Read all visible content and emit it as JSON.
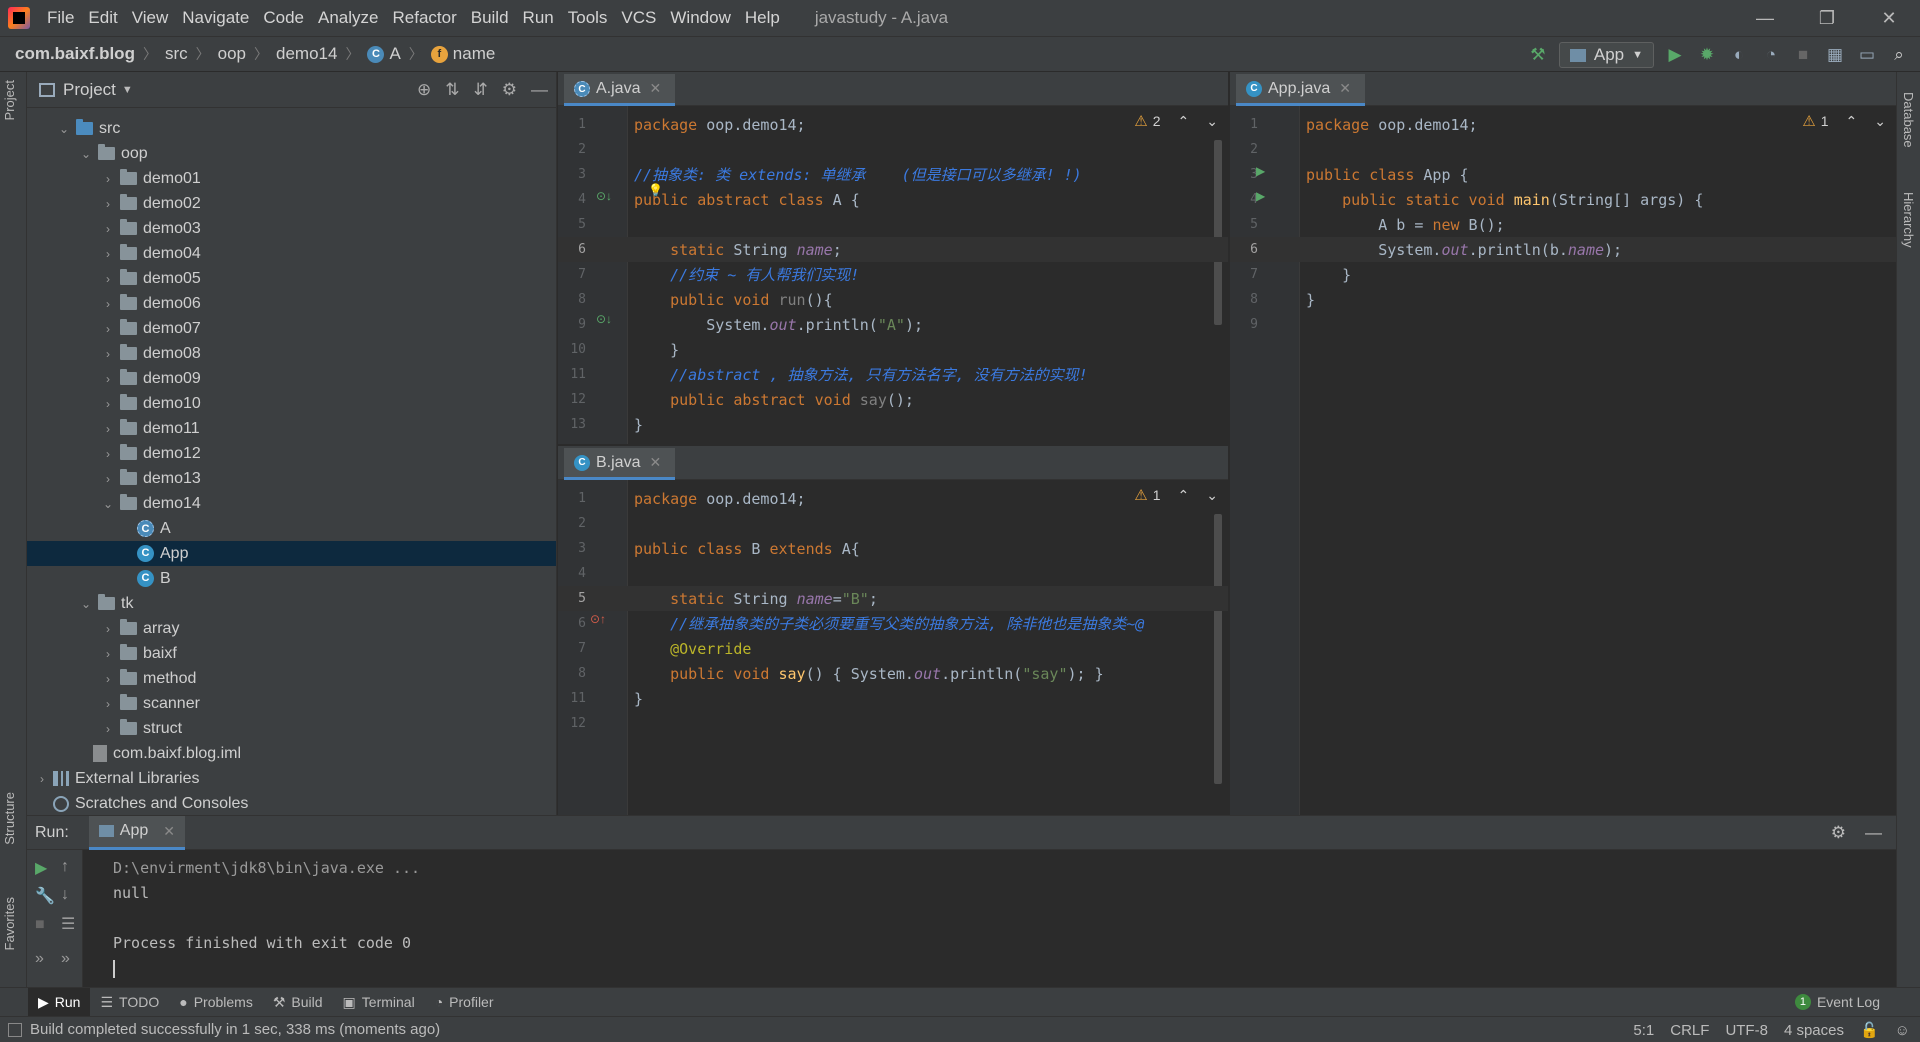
{
  "menu": [
    "File",
    "Edit",
    "View",
    "Navigate",
    "Code",
    "Analyze",
    "Refactor",
    "Build",
    "Run",
    "Tools",
    "VCS",
    "Window",
    "Help"
  ],
  "window_title": "javastudy - A.java",
  "breadcrumbs": [
    "com.baixf.blog",
    "src",
    "oop",
    "demo14",
    "A",
    "name"
  ],
  "run_config": "App",
  "project_pane": {
    "title": "Project",
    "tree": [
      {
        "label": "src",
        "indent": 1,
        "type": "src-folder",
        "arrow": "⌄"
      },
      {
        "label": "oop",
        "indent": 2,
        "type": "folder",
        "arrow": "⌄"
      },
      {
        "label": "demo01",
        "indent": 3,
        "type": "folder",
        "arrow": "›"
      },
      {
        "label": "demo02",
        "indent": 3,
        "type": "folder",
        "arrow": "›"
      },
      {
        "label": "demo03",
        "indent": 3,
        "type": "folder",
        "arrow": "›"
      },
      {
        "label": "demo04",
        "indent": 3,
        "type": "folder",
        "arrow": "›"
      },
      {
        "label": "demo05",
        "indent": 3,
        "type": "folder",
        "arrow": "›"
      },
      {
        "label": "demo06",
        "indent": 3,
        "type": "folder",
        "arrow": "›"
      },
      {
        "label": "demo07",
        "indent": 3,
        "type": "folder",
        "arrow": "›"
      },
      {
        "label": "demo08",
        "indent": 3,
        "type": "folder",
        "arrow": "›"
      },
      {
        "label": "demo09",
        "indent": 3,
        "type": "folder",
        "arrow": "›"
      },
      {
        "label": "demo10",
        "indent": 3,
        "type": "folder",
        "arrow": "›"
      },
      {
        "label": "demo11",
        "indent": 3,
        "type": "folder",
        "arrow": "›"
      },
      {
        "label": "demo12",
        "indent": 3,
        "type": "folder",
        "arrow": "›"
      },
      {
        "label": "demo13",
        "indent": 3,
        "type": "folder",
        "arrow": "›"
      },
      {
        "label": "demo14",
        "indent": 3,
        "type": "folder",
        "arrow": "⌄"
      },
      {
        "label": "A",
        "indent": 4,
        "type": "abstract-class",
        "arrow": ""
      },
      {
        "label": "App",
        "indent": 4,
        "type": "class",
        "arrow": "",
        "selected": true
      },
      {
        "label": "B",
        "indent": 4,
        "type": "class",
        "arrow": ""
      },
      {
        "label": "tk",
        "indent": 2,
        "type": "folder",
        "arrow": "⌄"
      },
      {
        "label": "array",
        "indent": 3,
        "type": "folder",
        "arrow": "›"
      },
      {
        "label": "baixf",
        "indent": 3,
        "type": "folder",
        "arrow": "›"
      },
      {
        "label": "method",
        "indent": 3,
        "type": "folder",
        "arrow": "›"
      },
      {
        "label": "scanner",
        "indent": 3,
        "type": "folder",
        "arrow": "›"
      },
      {
        "label": "struct",
        "indent": 3,
        "type": "folder",
        "arrow": "›"
      },
      {
        "label": "com.baixf.blog.iml",
        "indent": 2,
        "type": "file",
        "arrow": ""
      },
      {
        "label": "External Libraries",
        "indent": 0,
        "type": "library",
        "arrow": "›"
      },
      {
        "label": "Scratches and Consoles",
        "indent": 0,
        "type": "scratch",
        "arrow": ""
      }
    ]
  },
  "editors": {
    "a_java": {
      "tab": "A.java",
      "warnings": "2",
      "lines": [
        {
          "n": "1",
          "html": "<span class=\"kw\">package</span> oop.demo14;"
        },
        {
          "n": "2",
          "html": ""
        },
        {
          "n": "3",
          "html": "<span class=\"cmt\">//抽象类: 类 extends: 单继承    (但是接口可以多继承! !)</span>"
        },
        {
          "n": "4",
          "html": "<span class=\"kw\">public abstract class</span> A {"
        },
        {
          "n": "5",
          "html": ""
        },
        {
          "n": "6",
          "html": "    <span class=\"kw\">static</span> String <span class=\"fld\">name</span>;",
          "current": true
        },
        {
          "n": "7",
          "html": "    <span class=\"cmt\">//约束 ~ 有人帮我们实现!</span>"
        },
        {
          "n": "8",
          "html": "    <span class=\"kw\">public void</span> <span class=\"gray\">run</span>(){"
        },
        {
          "n": "9",
          "html": "        System.<span class=\"fld\">out</span>.println(<span class=\"str\">\"A\"</span>);"
        },
        {
          "n": "10",
          "html": "    }"
        },
        {
          "n": "11",
          "html": "    <span class=\"cmt\">//abstract , 抽象方法, 只有方法名字, 没有方法的实现!</span>"
        },
        {
          "n": "12",
          "html": "    <span class=\"kw\">public abstract void</span> <span class=\"gray\">say</span>();"
        },
        {
          "n": "13",
          "html": "}"
        }
      ]
    },
    "b_java": {
      "tab": "B.java",
      "warnings": "1",
      "lines": [
        {
          "n": "1",
          "html": "<span class=\"kw\">package</span> oop.demo14;"
        },
        {
          "n": "2",
          "html": ""
        },
        {
          "n": "3",
          "html": "<span class=\"kw\">public class</span> B <span class=\"kw\">extends</span> A{"
        },
        {
          "n": "4",
          "html": ""
        },
        {
          "n": "5",
          "html": "    <span class=\"kw\">static</span> String <span class=\"fld\">name</span>=<span class=\"str\">\"B\"</span>;",
          "current": true
        },
        {
          "n": "6",
          "html": "    <span class=\"cmt\">//继承抽象类的子类必须要重写父类的抽象方法, 除非他也是抽象类~@</span>"
        },
        {
          "n": "7",
          "html": "    <span class=\"ann\">@Override</span>"
        },
        {
          "n": "8",
          "html": "    <span class=\"kw\">public void</span> <span class=\"fn\">say</span>() { System.<span class=\"fld\">out</span>.println(<span class=\"str\">\"say\"</span>); }"
        },
        {
          "n": "11",
          "html": "}"
        },
        {
          "n": "12",
          "html": ""
        }
      ]
    },
    "app_java": {
      "tab": "App.java",
      "warnings": "1",
      "lines": [
        {
          "n": "1",
          "html": "<span class=\"kw\">package</span> oop.demo14;"
        },
        {
          "n": "2",
          "html": ""
        },
        {
          "n": "3",
          "html": "<span class=\"kw\">public class</span> App {"
        },
        {
          "n": "4",
          "html": "    <span class=\"kw\">public static void</span> <span class=\"fn\">main</span>(String[] args) {"
        },
        {
          "n": "5",
          "html": "        A b = <span class=\"kw\">new</span> B();"
        },
        {
          "n": "6",
          "html": "        System.<span class=\"fld\">out</span>.println(b.<span class=\"fld\">name</span>);",
          "current": true
        },
        {
          "n": "7",
          "html": "    }"
        },
        {
          "n": "8",
          "html": "}"
        },
        {
          "n": "9",
          "html": ""
        }
      ]
    }
  },
  "run_pane": {
    "label": "Run:",
    "tab": "App",
    "console": [
      "D:\\envirment\\jdk8\\bin\\java.exe ...",
      "null",
      "",
      "Process finished with exit code 0"
    ]
  },
  "tool_windows": [
    "Run",
    "TODO",
    "Problems",
    "Build",
    "Terminal",
    "Profiler"
  ],
  "event_log": "Event Log",
  "event_log_count": "1",
  "status": {
    "message": "Build completed successfully in 1 sec, 338 ms (moments ago)",
    "position": "5:1",
    "line_sep": "CRLF",
    "encoding": "UTF-8",
    "indent": "4 spaces"
  },
  "side_tabs": {
    "left": [
      "Project",
      "Structure",
      "Favorites"
    ],
    "right": [
      "Database",
      "Hierarchy"
    ]
  },
  "colors": {
    "accent": "#4a88c7",
    "keyword": "#cc7832",
    "string": "#6a8759",
    "comment": "#3b7ae0",
    "field": "#9876aa"
  }
}
